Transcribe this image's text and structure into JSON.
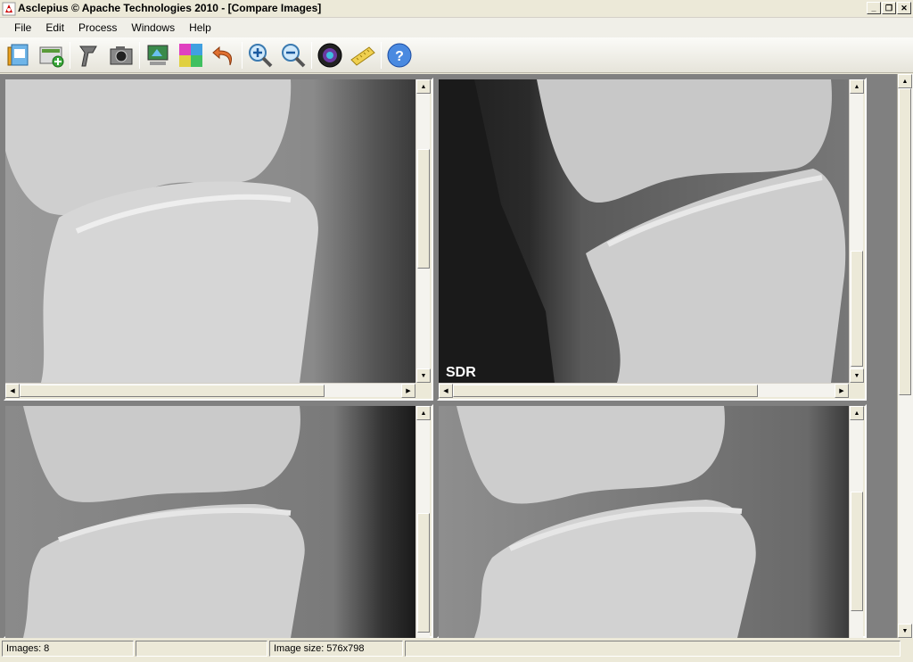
{
  "window": {
    "title": "Asclepius © Apache Technologies 2010 - [Compare Images]",
    "minimize_glyph": "_",
    "restore_glyph": "❐",
    "close_glyph": "✕"
  },
  "menu": {
    "items": [
      "File",
      "Edit",
      "Process",
      "Windows",
      "Help"
    ]
  },
  "toolbar": {
    "buttons": [
      {
        "icon": "open-folder-icon"
      },
      {
        "icon": "add-image-icon"
      },
      {
        "icon": "barcode-scanner-icon"
      },
      {
        "icon": "camera-icon"
      },
      {
        "icon": "monitor-icon"
      },
      {
        "icon": "color-palette-icon"
      },
      {
        "icon": "undo-icon"
      },
      {
        "icon": "zoom-in-icon"
      },
      {
        "icon": "zoom-out-icon"
      },
      {
        "icon": "lens-icon"
      },
      {
        "icon": "ruler-icon"
      },
      {
        "icon": "help-icon"
      }
    ]
  },
  "panes": [
    {
      "label": ""
    },
    {
      "label": "SDR"
    },
    {
      "label": ""
    },
    {
      "label": ""
    }
  ],
  "scroll_arrows": {
    "up": "▲",
    "down": "▼",
    "left": "◀",
    "right": "▶"
  },
  "status": {
    "images": "Images: 8",
    "cell2": "",
    "image_size": "Image size: 576x798",
    "cell4": ""
  }
}
